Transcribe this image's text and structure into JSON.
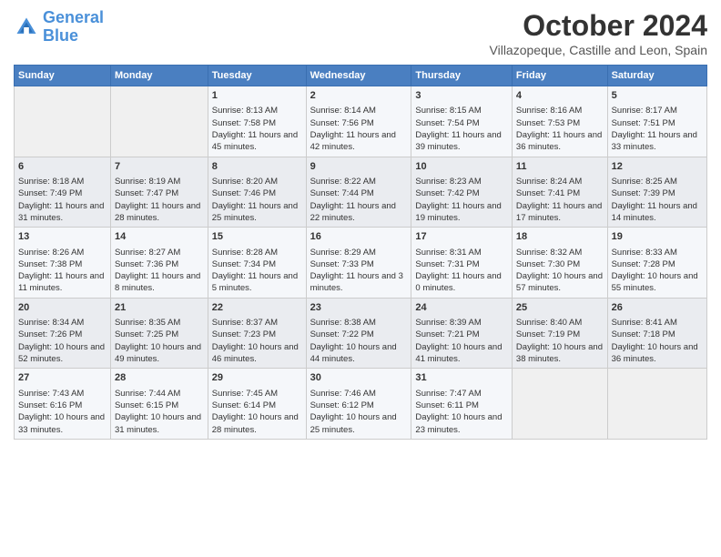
{
  "header": {
    "logo_line1": "General",
    "logo_line2": "Blue",
    "title": "October 2024",
    "subtitle": "Villazopeque, Castille and Leon, Spain"
  },
  "columns": [
    "Sunday",
    "Monday",
    "Tuesday",
    "Wednesday",
    "Thursday",
    "Friday",
    "Saturday"
  ],
  "weeks": [
    [
      {
        "day": "",
        "info": ""
      },
      {
        "day": "",
        "info": ""
      },
      {
        "day": "1",
        "info": "Sunrise: 8:13 AM\nSunset: 7:58 PM\nDaylight: 11 hours and 45 minutes."
      },
      {
        "day": "2",
        "info": "Sunrise: 8:14 AM\nSunset: 7:56 PM\nDaylight: 11 hours and 42 minutes."
      },
      {
        "day": "3",
        "info": "Sunrise: 8:15 AM\nSunset: 7:54 PM\nDaylight: 11 hours and 39 minutes."
      },
      {
        "day": "4",
        "info": "Sunrise: 8:16 AM\nSunset: 7:53 PM\nDaylight: 11 hours and 36 minutes."
      },
      {
        "day": "5",
        "info": "Sunrise: 8:17 AM\nSunset: 7:51 PM\nDaylight: 11 hours and 33 minutes."
      }
    ],
    [
      {
        "day": "6",
        "info": "Sunrise: 8:18 AM\nSunset: 7:49 PM\nDaylight: 11 hours and 31 minutes."
      },
      {
        "day": "7",
        "info": "Sunrise: 8:19 AM\nSunset: 7:47 PM\nDaylight: 11 hours and 28 minutes."
      },
      {
        "day": "8",
        "info": "Sunrise: 8:20 AM\nSunset: 7:46 PM\nDaylight: 11 hours and 25 minutes."
      },
      {
        "day": "9",
        "info": "Sunrise: 8:22 AM\nSunset: 7:44 PM\nDaylight: 11 hours and 22 minutes."
      },
      {
        "day": "10",
        "info": "Sunrise: 8:23 AM\nSunset: 7:42 PM\nDaylight: 11 hours and 19 minutes."
      },
      {
        "day": "11",
        "info": "Sunrise: 8:24 AM\nSunset: 7:41 PM\nDaylight: 11 hours and 17 minutes."
      },
      {
        "day": "12",
        "info": "Sunrise: 8:25 AM\nSunset: 7:39 PM\nDaylight: 11 hours and 14 minutes."
      }
    ],
    [
      {
        "day": "13",
        "info": "Sunrise: 8:26 AM\nSunset: 7:38 PM\nDaylight: 11 hours and 11 minutes."
      },
      {
        "day": "14",
        "info": "Sunrise: 8:27 AM\nSunset: 7:36 PM\nDaylight: 11 hours and 8 minutes."
      },
      {
        "day": "15",
        "info": "Sunrise: 8:28 AM\nSunset: 7:34 PM\nDaylight: 11 hours and 5 minutes."
      },
      {
        "day": "16",
        "info": "Sunrise: 8:29 AM\nSunset: 7:33 PM\nDaylight: 11 hours and 3 minutes."
      },
      {
        "day": "17",
        "info": "Sunrise: 8:31 AM\nSunset: 7:31 PM\nDaylight: 11 hours and 0 minutes."
      },
      {
        "day": "18",
        "info": "Sunrise: 8:32 AM\nSunset: 7:30 PM\nDaylight: 10 hours and 57 minutes."
      },
      {
        "day": "19",
        "info": "Sunrise: 8:33 AM\nSunset: 7:28 PM\nDaylight: 10 hours and 55 minutes."
      }
    ],
    [
      {
        "day": "20",
        "info": "Sunrise: 8:34 AM\nSunset: 7:26 PM\nDaylight: 10 hours and 52 minutes."
      },
      {
        "day": "21",
        "info": "Sunrise: 8:35 AM\nSunset: 7:25 PM\nDaylight: 10 hours and 49 minutes."
      },
      {
        "day": "22",
        "info": "Sunrise: 8:37 AM\nSunset: 7:23 PM\nDaylight: 10 hours and 46 minutes."
      },
      {
        "day": "23",
        "info": "Sunrise: 8:38 AM\nSunset: 7:22 PM\nDaylight: 10 hours and 44 minutes."
      },
      {
        "day": "24",
        "info": "Sunrise: 8:39 AM\nSunset: 7:21 PM\nDaylight: 10 hours and 41 minutes."
      },
      {
        "day": "25",
        "info": "Sunrise: 8:40 AM\nSunset: 7:19 PM\nDaylight: 10 hours and 38 minutes."
      },
      {
        "day": "26",
        "info": "Sunrise: 8:41 AM\nSunset: 7:18 PM\nDaylight: 10 hours and 36 minutes."
      }
    ],
    [
      {
        "day": "27",
        "info": "Sunrise: 7:43 AM\nSunset: 6:16 PM\nDaylight: 10 hours and 33 minutes."
      },
      {
        "day": "28",
        "info": "Sunrise: 7:44 AM\nSunset: 6:15 PM\nDaylight: 10 hours and 31 minutes."
      },
      {
        "day": "29",
        "info": "Sunrise: 7:45 AM\nSunset: 6:14 PM\nDaylight: 10 hours and 28 minutes."
      },
      {
        "day": "30",
        "info": "Sunrise: 7:46 AM\nSunset: 6:12 PM\nDaylight: 10 hours and 25 minutes."
      },
      {
        "day": "31",
        "info": "Sunrise: 7:47 AM\nSunset: 6:11 PM\nDaylight: 10 hours and 23 minutes."
      },
      {
        "day": "",
        "info": ""
      },
      {
        "day": "",
        "info": ""
      }
    ]
  ]
}
